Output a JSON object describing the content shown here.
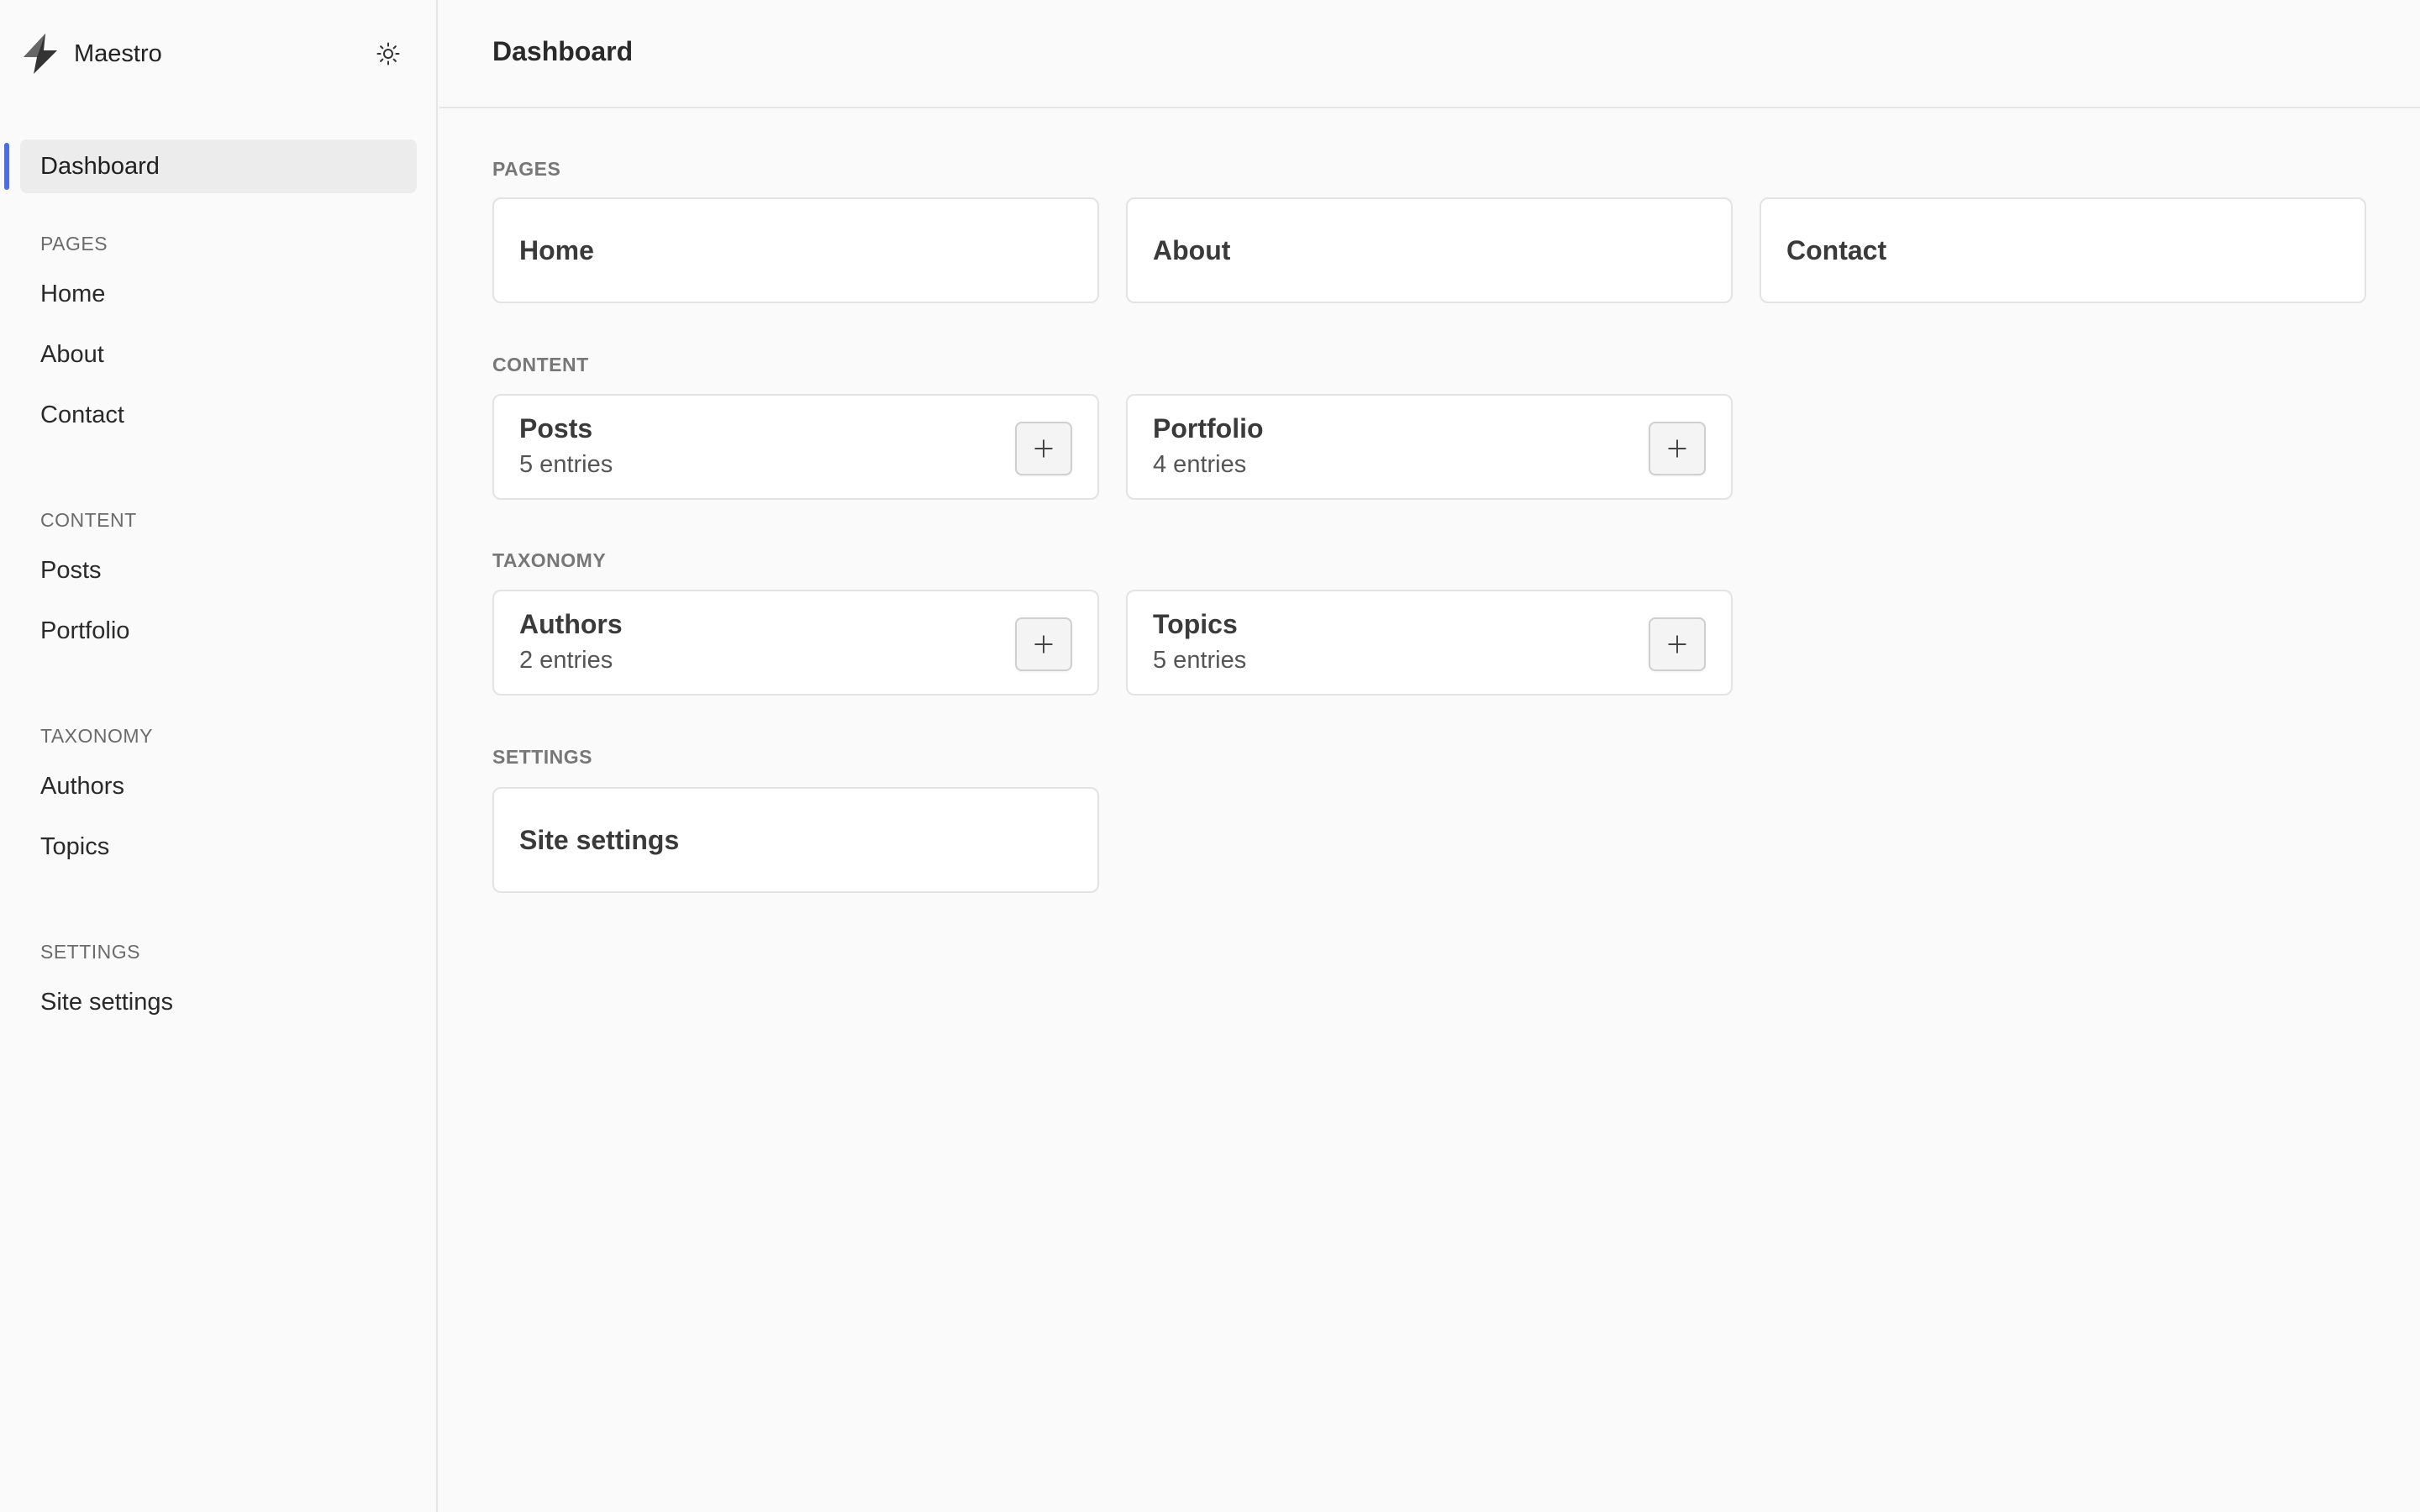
{
  "app": {
    "name": "Maestro"
  },
  "sidebar": {
    "active_item": "Dashboard",
    "sections": [
      {
        "label": "PAGES",
        "items": [
          "Home",
          "About",
          "Contact"
        ]
      },
      {
        "label": "CONTENT",
        "items": [
          "Posts",
          "Portfolio"
        ]
      },
      {
        "label": "TAXONOMY",
        "items": [
          "Authors",
          "Topics"
        ]
      },
      {
        "label": "SETTINGS",
        "items": [
          "Site settings"
        ]
      }
    ]
  },
  "header": {
    "title": "Dashboard"
  },
  "main": {
    "sections": [
      {
        "label": "PAGES",
        "cards": [
          {
            "title": "Home"
          },
          {
            "title": "About"
          },
          {
            "title": "Contact"
          }
        ]
      },
      {
        "label": "CONTENT",
        "cards": [
          {
            "title": "Posts",
            "subtitle": "5 entries"
          },
          {
            "title": "Portfolio",
            "subtitle": "4 entries"
          }
        ]
      },
      {
        "label": "TAXONOMY",
        "cards": [
          {
            "title": "Authors",
            "subtitle": "2 entries"
          },
          {
            "title": "Topics",
            "subtitle": "5 entries"
          }
        ]
      },
      {
        "label": "SETTINGS",
        "cards": [
          {
            "title": "Site settings"
          }
        ]
      }
    ]
  },
  "icons": {
    "logo": "lightning-logo-icon",
    "theme": "sun-icon",
    "add": "plus-icon"
  },
  "colors": {
    "accent": "#4a6cf0",
    "background": "#fafafa",
    "card": "#ffffff",
    "border": "#e3e3e3"
  }
}
